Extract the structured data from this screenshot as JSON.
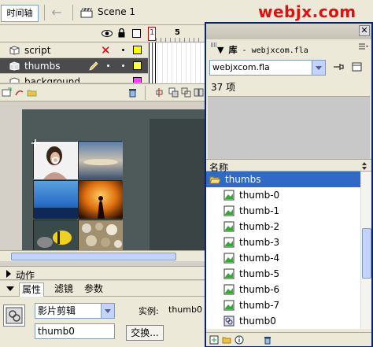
{
  "topbar": {
    "timeline_tab": "时间轴",
    "scene_label": "Scene 1",
    "watermark": "webjx.com"
  },
  "timeline": {
    "frame_numbers": [
      "1",
      "5"
    ],
    "layers": [
      {
        "name": "script",
        "selected": false
      },
      {
        "name": "thumbs",
        "selected": true
      },
      {
        "name": "background",
        "selected": false
      }
    ]
  },
  "panels": {
    "actions_label": "动作",
    "properties_tabs": [
      "属性",
      "滤镜",
      "参数"
    ],
    "symbol_type": "影片剪辑",
    "instance_name_value": "thumb0",
    "instance_label": "实例:",
    "instance_symbol": "thumb0",
    "swap_button": "交换..."
  },
  "library": {
    "title_prefix": "库",
    "title_file": "webjxcom.fla",
    "file_select": "webjxcom.fla",
    "item_count": "37 项",
    "column_name": "名称",
    "folder": "thumbs",
    "items": [
      "thumb-0",
      "thumb-1",
      "thumb-2",
      "thumb-3",
      "thumb-4",
      "thumb-5",
      "thumb-6",
      "thumb-7",
      "thumb0"
    ]
  },
  "colors": {
    "accent_selection": "#316ac5",
    "watermark_red": "#e01010",
    "stage_dark": "#4e5a5a"
  }
}
